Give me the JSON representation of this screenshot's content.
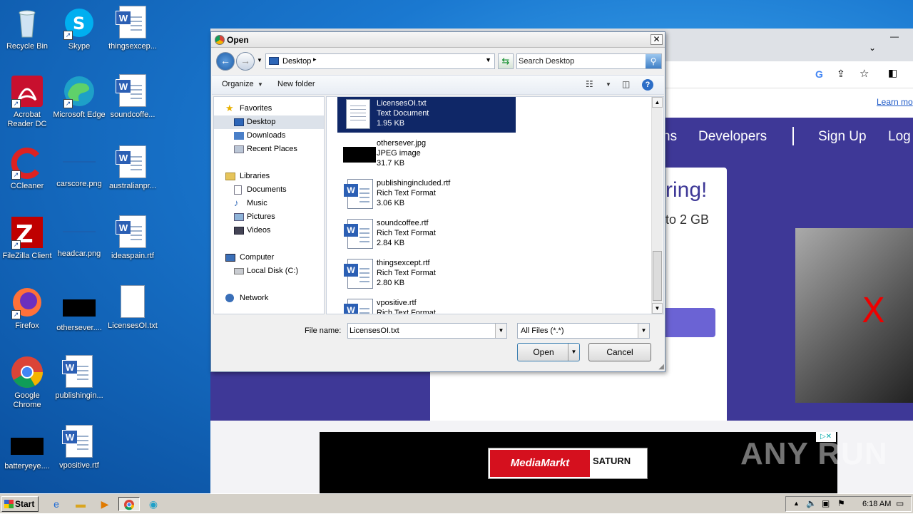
{
  "desktop": {
    "icons": [
      {
        "label": "Recycle Bin",
        "icon": "recycle-bin-icon"
      },
      {
        "label": "Skype",
        "icon": "skype-icon"
      },
      {
        "label": "thingsexcep...",
        "icon": "word-document-icon"
      },
      {
        "label": "Acrobat Reader DC",
        "icon": "acrobat-icon"
      },
      {
        "label": "Microsoft Edge",
        "icon": "edge-icon"
      },
      {
        "label": "soundcoffe...",
        "icon": "word-document-icon"
      },
      {
        "label": "CCleaner",
        "icon": "ccleaner-icon"
      },
      {
        "label": "carscore.png",
        "icon": "image-file-icon"
      },
      {
        "label": "australianpr...",
        "icon": "word-document-icon"
      },
      {
        "label": "FileZilla Client",
        "icon": "filezilla-icon"
      },
      {
        "label": "headcar.png",
        "icon": "image-file-icon"
      },
      {
        "label": "ideaspain.rtf",
        "icon": "word-document-icon"
      },
      {
        "label": "Firefox",
        "icon": "firefox-icon"
      },
      {
        "label": "othersever....",
        "icon": "image-file-icon"
      },
      {
        "label": "LicensesOI.txt",
        "icon": "text-file-icon"
      },
      {
        "label": "Google Chrome",
        "icon": "chrome-icon"
      },
      {
        "label": "publishingin...",
        "icon": "word-document-icon"
      },
      {
        "label": "batteryeye....",
        "icon": "image-file-icon"
      },
      {
        "label": "vpositive.rtf",
        "icon": "word-document-icon"
      }
    ]
  },
  "browser": {
    "nav_links": [
      "ns",
      "Developers",
      "Sign Up",
      "Log"
    ],
    "learn_more": "Learn mo",
    "hero_title": "ring!",
    "hero_sub": "to 2 GB"
  },
  "ad": {
    "brand1": "MediaMarkt",
    "brand2": "SATURN"
  },
  "watermark": "ANY RUN",
  "dialog": {
    "title": "Open",
    "location": "Desktop",
    "search_placeholder": "Search Desktop",
    "toolbar": {
      "organize": "Organize",
      "new_folder": "New folder"
    },
    "nav_pane": {
      "favorites": "Favorites",
      "desktop": "Desktop",
      "downloads": "Downloads",
      "recent": "Recent Places",
      "libraries": "Libraries",
      "documents": "Documents",
      "music": "Music",
      "pictures": "Pictures",
      "videos": "Videos",
      "computer": "Computer",
      "local_disk": "Local Disk (C:)",
      "network": "Network"
    },
    "files": [
      {
        "name": "LicensesOI.txt",
        "type": "Text Document",
        "size": "1.95 KB",
        "selected": true
      },
      {
        "name": "othersever.jpg",
        "type": "JPEG image",
        "size": "31.7 KB"
      },
      {
        "name": "publishingincluded.rtf",
        "type": "Rich Text Format",
        "size": "3.06 KB"
      },
      {
        "name": "soundcoffee.rtf",
        "type": "Rich Text Format",
        "size": "2.84 KB"
      },
      {
        "name": "thingsexcept.rtf",
        "type": "Rich Text Format",
        "size": "2.80 KB"
      },
      {
        "name": "vpositive.rtf",
        "type": "Rich Text Format",
        "size": ""
      }
    ],
    "file_name_label": "File name:",
    "file_name_value": "LicensesOI.txt",
    "file_type_value": "All Files (*.*)",
    "open_label": "Open",
    "cancel_label": "Cancel"
  },
  "taskbar": {
    "start_label": "Start",
    "clock": "6:18 AM"
  }
}
